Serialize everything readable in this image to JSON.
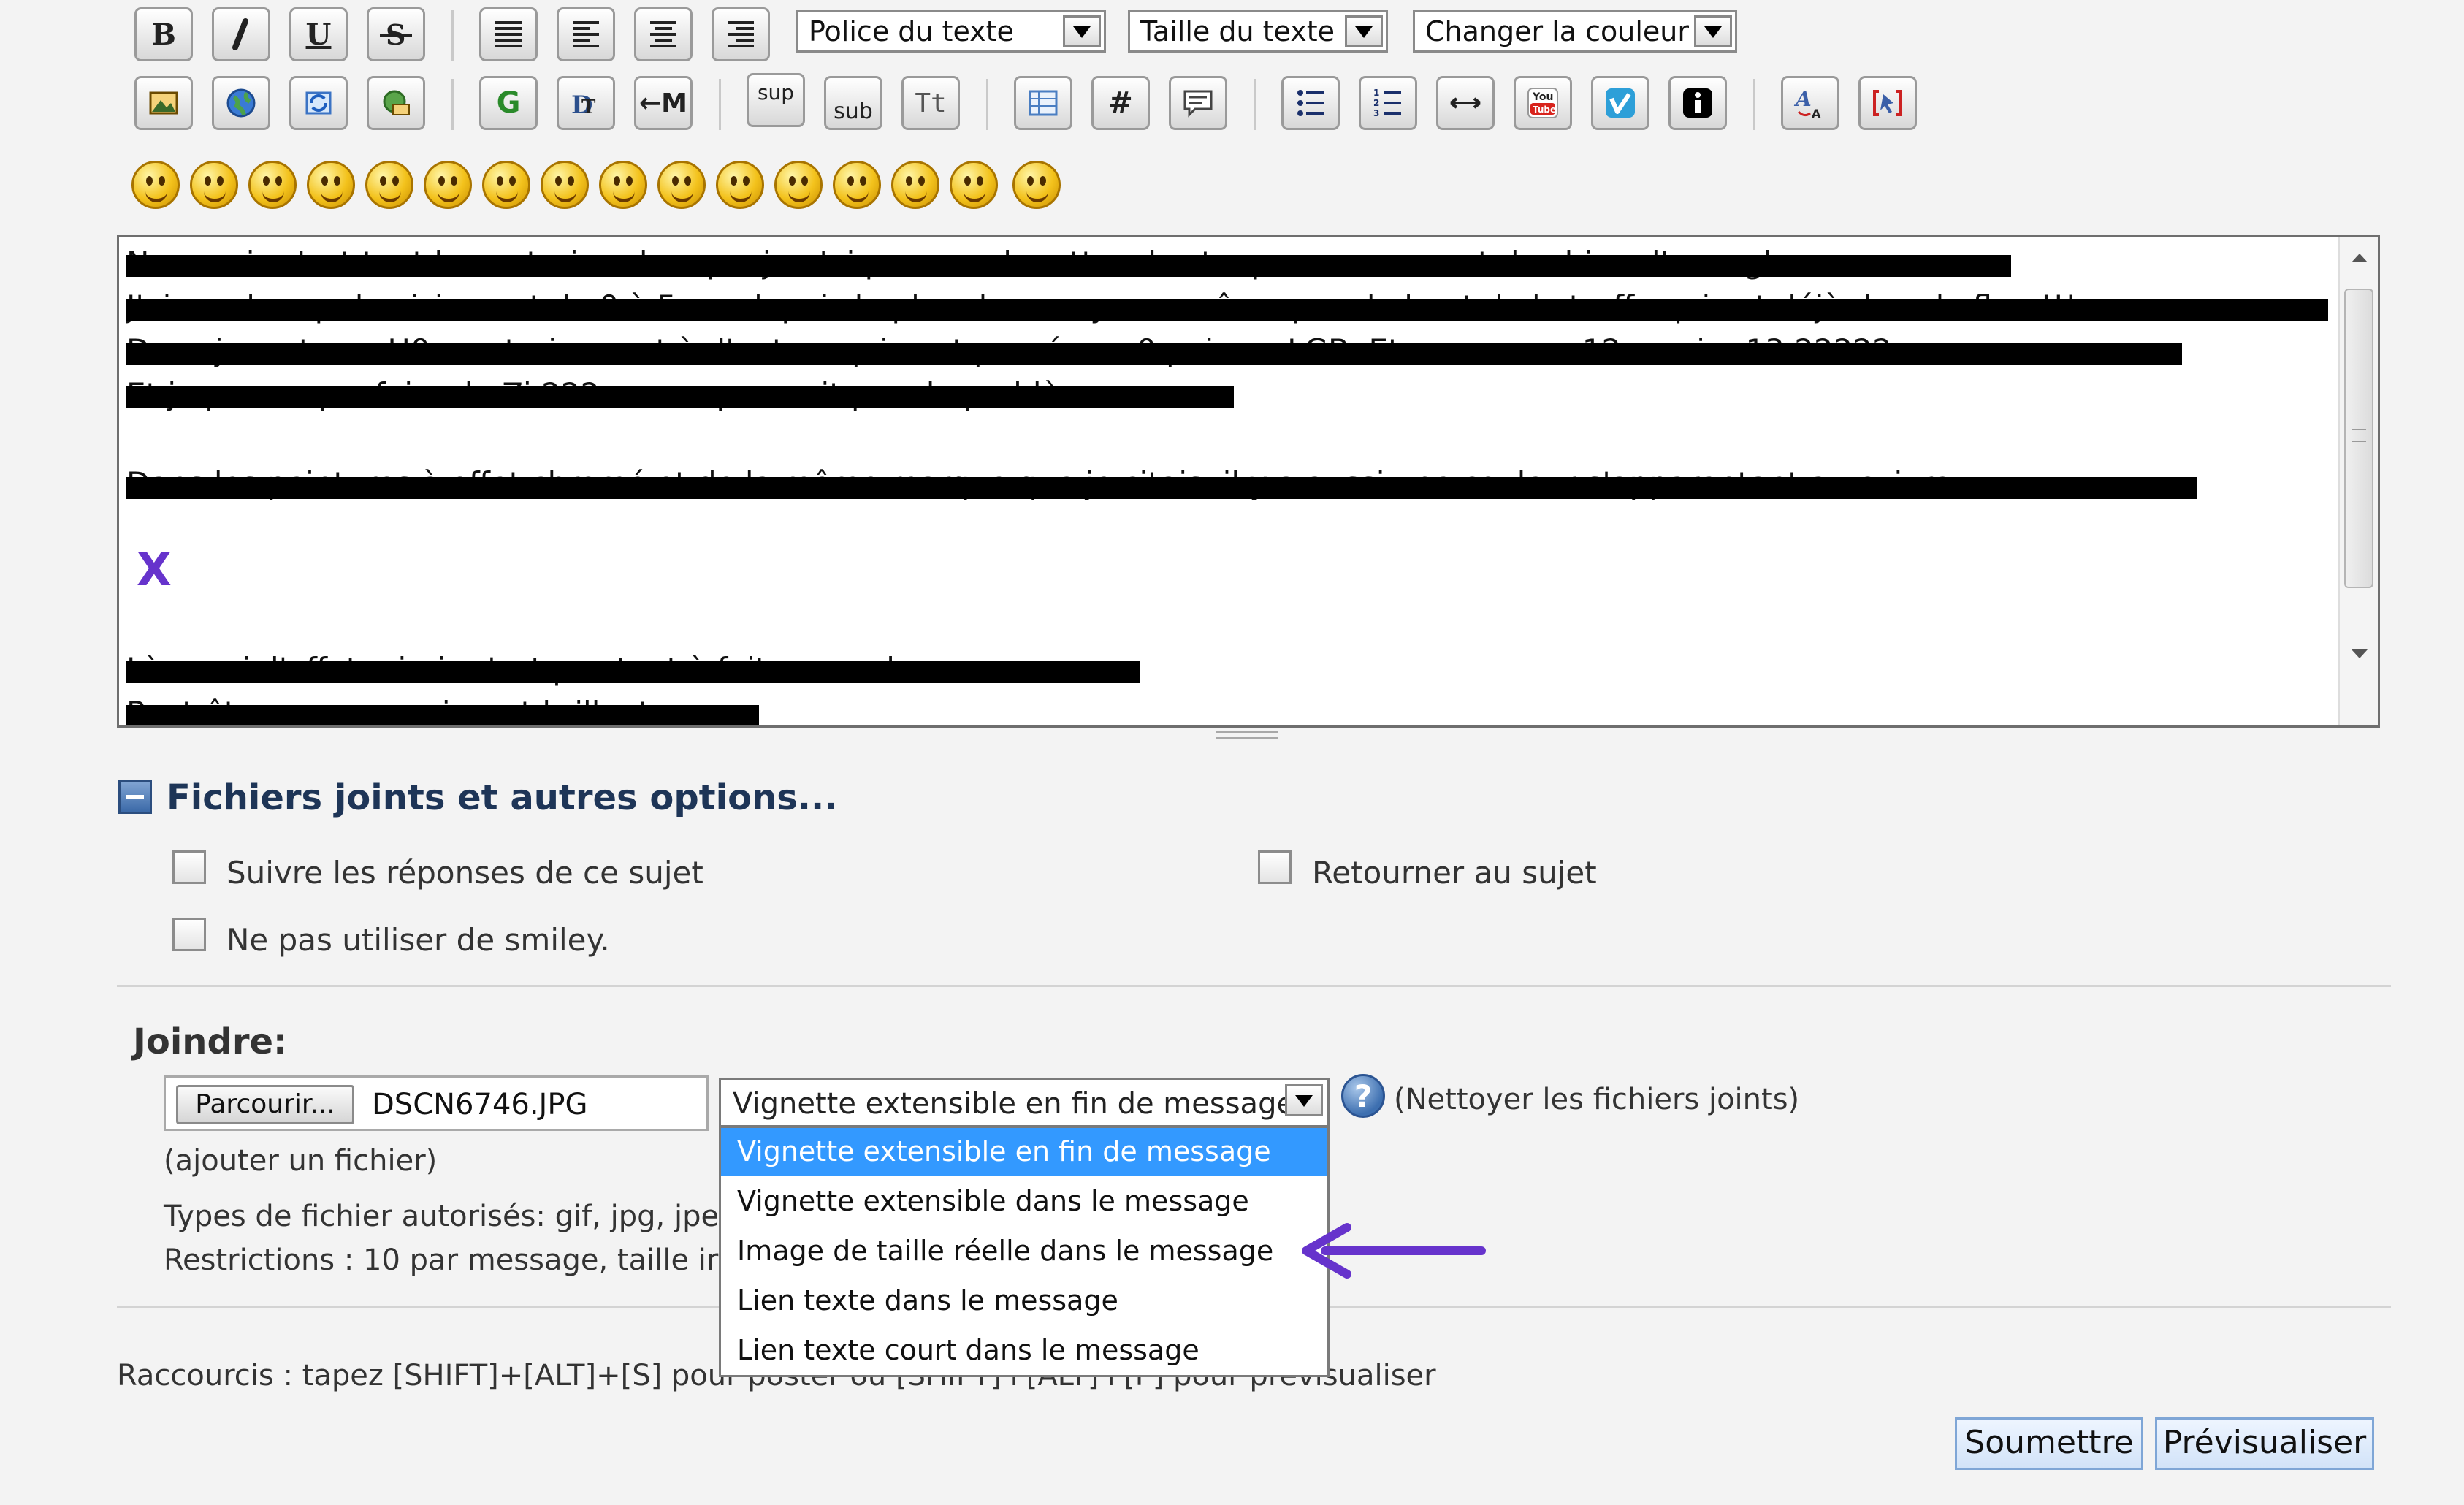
{
  "toolbar": {
    "font_select": "Police du texte",
    "size_select": "Taille du texte",
    "color_select": "Changer la couleur",
    "bold": "B",
    "underline": "U",
    "sup": "sup",
    "sub": "sub",
    "tt": "Tt",
    "hash": "#",
    "g": "G",
    "m": "←M",
    "youtube": "You Tube",
    "vimeo": "V",
    "info": "i"
  },
  "editor": {
    "lines": [
      "Non mais c'est tout le contraire : lorsque je n'ai pas mes lunettes, les taupes me servent de chien d'aveugle",
      "J'ai un champ de vision net de 0 à 5 cm depuis le plan de mes yeux, même pas du bout de la truffe qui est déjà dans le flou !!!",
      "Donc je reste au H0, contrairement à d'autres qui sont passés au 0 puis au LGB. Et encore, au 12e, voire 13,22222... e",
      "Et je pense que faire du Zi 222 ne me poserait pas de problème",
      "Dans les peintures à effet chromé et de la même marque que je citais, il y a aussi une couleur s'apparentant au cuivre :",
      "Là aussi, l'effet miroir n'est pas tout à fait au rendez-vous",
      "Peut-être ou un vernissant brillant..."
    ],
    "marker": "X"
  },
  "options": {
    "header": "Fichiers joints et autres options...",
    "follow": "Suivre les réponses de ce sujet",
    "return": "Retourner au sujet",
    "nosmiley": "Ne pas utiliser de smiley."
  },
  "attach": {
    "title": "Joindre:",
    "browse": "Parcourir...",
    "filename": "DSCN6746.JPG",
    "selected": "Vignette extensible en fin de message",
    "options": [
      "Vignette extensible en fin de message",
      "Vignette extensible dans le message",
      "Image de taille réelle dans le message",
      "Lien texte dans le message",
      "Lien texte court dans le message"
    ],
    "help": "?",
    "clean": "(Nettoyer les fichiers joints)",
    "add": "(ajouter un fichier)",
    "types": "Types de fichier autorisés: gif, jpg, jpe",
    "restrictions": "Restrictions : 10 par message, taille ir"
  },
  "shortcuts": "Raccourcis : tapez [SHIFT]+[ALT]+[S] pour poster ou [SHIFT]+[ALT]+[P] pour prévisualiser",
  "buttons": {
    "submit": "Soumettre",
    "preview": "Prévisualiser"
  },
  "colors": {
    "arrow": "#6633cc",
    "selection": "#3399ff",
    "marker": "#6633cc"
  }
}
